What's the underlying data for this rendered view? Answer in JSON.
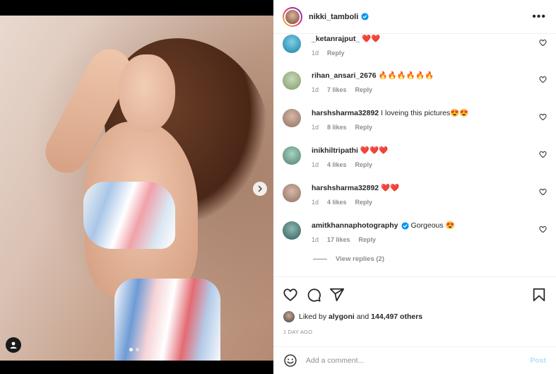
{
  "post": {
    "author": "nikki_tamboli",
    "more_icon": "more-horizontal-icon",
    "verified_icon": "verified-badge-icon",
    "slide_count": 2,
    "active_slide": 1
  },
  "comments": [
    {
      "user": "_ketanrajput_",
      "text": "❤️❤️",
      "time": "1d",
      "likes": "",
      "reply": "Reply",
      "avatar_color": "#1b7fa3"
    },
    {
      "user": "rihan_ansari_2676",
      "text": "🔥🔥🔥🔥🔥🔥",
      "time": "1d",
      "likes": "7 likes",
      "reply": "Reply",
      "avatar_color": "#7d9a6a"
    },
    {
      "user": "harshsharma32892",
      "text": "I loveing this pictures😍😍",
      "time": "1d",
      "likes": "8 likes",
      "reply": "Reply",
      "avatar_color": "#8c7062"
    },
    {
      "user": "inikhiltripathi",
      "text": "❤️❤️❤️",
      "time": "1d",
      "likes": "4 likes",
      "reply": "Reply",
      "avatar_color": "#4e7f6d"
    },
    {
      "user": "harshsharma32892",
      "text": "❤️❤️",
      "time": "1d",
      "likes": "4 likes",
      "reply": "Reply",
      "avatar_color": "#8c7062"
    },
    {
      "user": "amitkhannaphotography",
      "text": "Gorgeous 😍",
      "time": "1d",
      "likes": "17 likes",
      "reply": "Reply",
      "avatar_color": "#2f5d5a",
      "verified": true
    }
  ],
  "view_replies": "View replies (2)",
  "likes": {
    "prefix": "Liked by",
    "user": "alygoni",
    "and": "and",
    "others": "144,497 others"
  },
  "timestamp": "1 DAY AGO",
  "add_comment": {
    "placeholder": "Add a comment...",
    "post_label": "Post"
  },
  "colors": {
    "accent": "#0095f6",
    "post_disabled": "#b2dffc",
    "muted": "#8e8e8e"
  }
}
